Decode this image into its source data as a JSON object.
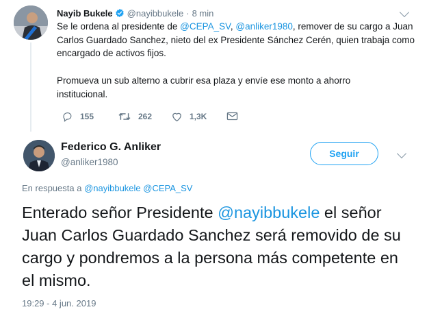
{
  "parent_tweet": {
    "name": "Nayib Bukele",
    "handle": "@nayibbukele",
    "separator": "·",
    "time": "8 min",
    "text_parts": [
      "Se le ordena al presidente de ",
      "@CEPA_SV",
      ", ",
      "@anliker1980",
      ", remover de su cargo a Juan Carlos Guardado Sanchez, nieto del ex Presidente Sánchez Cerén, quien trabaja como encargado de activos fijos."
    ],
    "paragraph2": "Promueva un sub alterno a cubrir esa plaza y envíe ese monto a ahorro institucional.",
    "actions": {
      "replies": "155",
      "retweets": "262",
      "likes": "1,3K"
    }
  },
  "main_tweet": {
    "name": "Federico G. Anliker",
    "handle": "@anliker1980",
    "follow_label": "Seguir",
    "reply_prefix": "En respuesta a ",
    "reply_to": "@nayibbukele @CEPA_SV",
    "text_before": "Enterado señor Presidente ",
    "text_mention": "@nayibbukele",
    "text_after": " el señor Juan Carlos Guardado Sanchez será removido de su cargo y pondremos a la persona más competente en el mismo.",
    "timestamp": "19:29 - 4 jun. 2019"
  },
  "colors": {
    "accent": "#1da1f2",
    "link": "#1b95e0",
    "muted": "#657786"
  },
  "icons": [
    "verified-badge-icon",
    "chevron-down-icon",
    "reply-icon",
    "retweet-icon",
    "like-icon",
    "direct-message-icon"
  ]
}
